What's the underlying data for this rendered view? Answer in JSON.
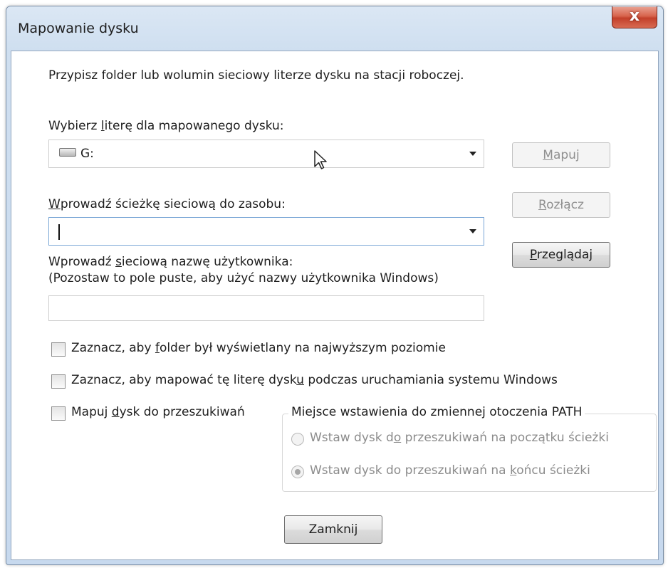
{
  "window": {
    "title": "Mapowanie dysku",
    "close_glyph": "x"
  },
  "intro_text": "Przypisz folder lub wolumin sieciowy literze dysku na stacji roboczej.",
  "drive_letter": {
    "label_pre": "Wybierz ",
    "label_accel": "l",
    "label_post": "iterę dla mapowanego dysku:",
    "value": "G:",
    "icon": "drive-icon"
  },
  "network_path": {
    "label_accel": "W",
    "label_post": "prowadź ścieżkę sieciową do zasobu:",
    "value": ""
  },
  "username": {
    "label_pre": "Wprowadź ",
    "label_accel": "s",
    "label_post": "ieciową nazwę użytkownika:",
    "hint": "(Pozostaw to pole puste, aby użyć nazwy użytkownika Windows)",
    "value": ""
  },
  "buttons": {
    "map": {
      "accel": "M",
      "rest": "apuj",
      "enabled": false
    },
    "disconnect": {
      "accel": "R",
      "rest": "ozłącz",
      "enabled": false
    },
    "browse": {
      "accel": "P",
      "rest": "rzeglądaj",
      "enabled": true
    },
    "close": {
      "label": "Zamknij"
    }
  },
  "checkboxes": [
    {
      "pre": "Zaznacz, aby ",
      "accel": "f",
      "post": "older był wyświetlany na najwyższym poziomie",
      "checked": false
    },
    {
      "pre": "Zaznacz, aby mapować tę literę dysk",
      "accel": "u",
      "post": " podczas uruchamiania systemu Windows",
      "checked": false
    },
    {
      "pre": "Mapuj ",
      "accel": "d",
      "post": "ysk do przeszukiwań",
      "checked": false
    }
  ],
  "path_group": {
    "title": "Miejsce wstawienia do zmiennej otoczenia PATH",
    "options": [
      {
        "pre": "Wstaw dysk d",
        "accel": "o",
        "post": " przeszukiwań na początku ścieżki",
        "selected": false
      },
      {
        "pre": "Wstaw dysk do przeszukiwań na ",
        "accel": "k",
        "post": "ońcu ścieżki",
        "selected": true
      }
    ],
    "enabled": false
  },
  "colors": {
    "title_bar": "#cfdff0",
    "close_button": "#c3402a",
    "disabled_text": "#8c8c8c"
  }
}
